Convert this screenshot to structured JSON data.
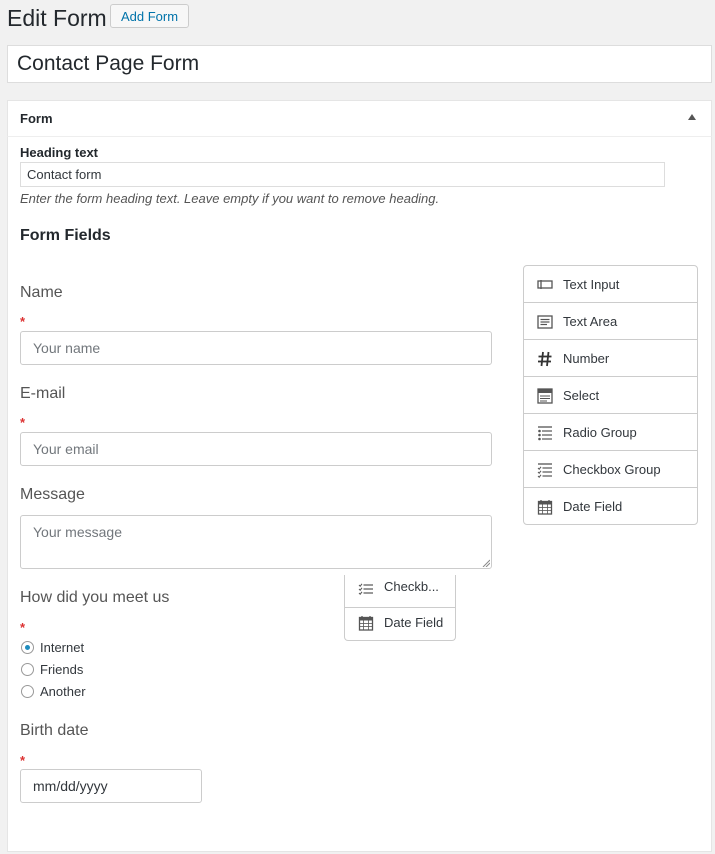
{
  "header": {
    "title": "Edit Form",
    "add_button": "Add Form"
  },
  "form_title": "Contact Page Form",
  "panel": {
    "title": "Form",
    "heading_label": "Heading text",
    "heading_value": "Contact form",
    "heading_desc": "Enter the form heading text. Leave empty if you want to remove heading.",
    "fields_title": "Form Fields"
  },
  "fields": {
    "name": {
      "label": "Name",
      "required": "*",
      "placeholder": "Your name"
    },
    "email": {
      "label": "E-mail",
      "required": "*",
      "placeholder": "Your email"
    },
    "message": {
      "label": "Message",
      "placeholder": "Your message"
    },
    "meet": {
      "label": "How did you meet us",
      "required": "*",
      "options": [
        "Internet",
        "Friends",
        "Another"
      ],
      "selected": "Internet"
    },
    "birth": {
      "label": "Birth date",
      "required": "*",
      "placeholder": "mm/dd/yyyy"
    }
  },
  "palette": {
    "items": [
      {
        "label": "Text Input",
        "icon": "text-input-icon"
      },
      {
        "label": "Text Area",
        "icon": "text-area-icon"
      },
      {
        "label": "Number",
        "icon": "hash-icon"
      },
      {
        "label": "Select",
        "icon": "select-icon"
      },
      {
        "label": "Radio Group",
        "icon": "radio-group-icon"
      },
      {
        "label": "Checkbox Group",
        "icon": "checkbox-group-icon"
      },
      {
        "label": "Date Field",
        "icon": "calendar-icon"
      }
    ]
  },
  "dragging": {
    "items": [
      {
        "label": "Checkb...",
        "icon": "checkbox-group-icon"
      },
      {
        "label": "Date Field",
        "icon": "calendar-icon"
      }
    ]
  },
  "colors": {
    "link": "#0073aa",
    "required": "#dc3232",
    "radio_checked": "#1e8cbe"
  }
}
